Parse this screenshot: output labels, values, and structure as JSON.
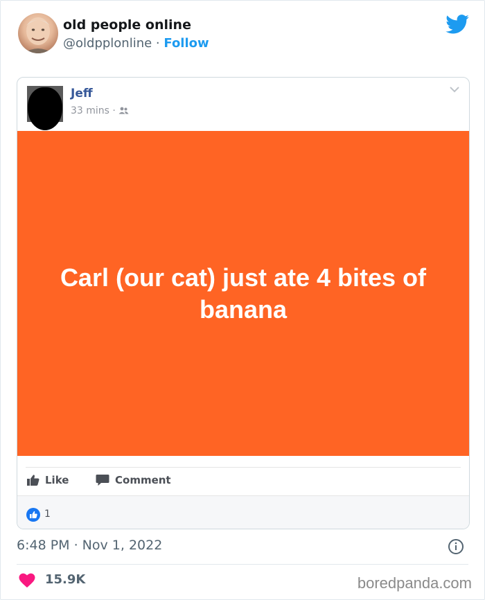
{
  "tweet": {
    "author_name": "old people online",
    "handle": "@oldpplonline",
    "separator": " · ",
    "follow_label": "Follow",
    "timestamp": "6:48 PM · Nov 1, 2022",
    "likes": "15.9K",
    "icons": [
      "twitter-logo",
      "info-icon",
      "heart-icon"
    ]
  },
  "fb_post": {
    "author": "Jeff",
    "time": "33 mins · ",
    "audience_icon": "friends-icon",
    "text": "Carl (our cat) just ate 4 bites of banana",
    "background_color": "#ff6424",
    "like_label": "Like",
    "comment_label": "Comment",
    "like_count": "1"
  },
  "watermark": "boredpanda.com",
  "colors": {
    "accent": "#1d9bf0",
    "heart": "#f91880",
    "fb_blue": "#365899"
  }
}
